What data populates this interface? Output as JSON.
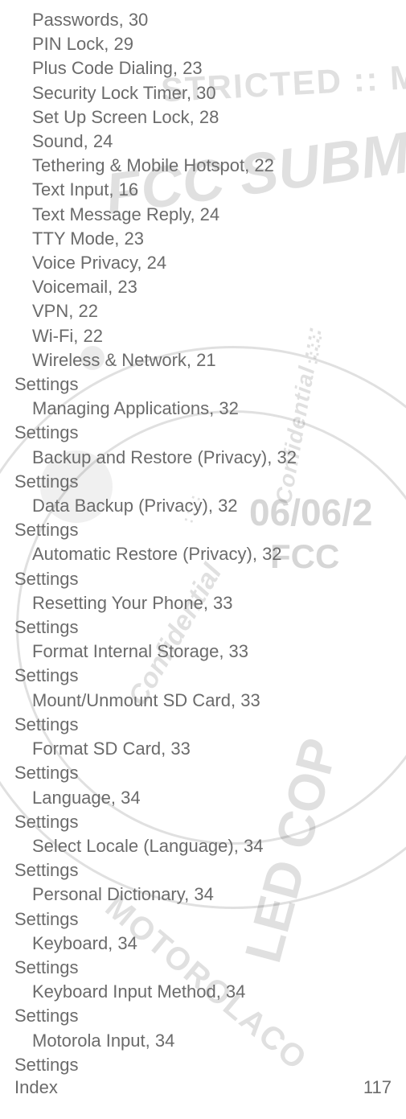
{
  "entries": [
    {
      "level": "sub",
      "text": "Passwords, 30"
    },
    {
      "level": "sub",
      "text": "PIN Lock, 29"
    },
    {
      "level": "sub",
      "text": "Plus Code Dialing, 23"
    },
    {
      "level": "sub",
      "text": "Security Lock Timer, 30"
    },
    {
      "level": "sub",
      "text": "Set Up Screen Lock, 28"
    },
    {
      "level": "sub",
      "text": "Sound, 24"
    },
    {
      "level": "sub",
      "text": "Tethering & Mobile Hotspot, 22"
    },
    {
      "level": "sub",
      "text": "Text Input, 16"
    },
    {
      "level": "sub",
      "text": "Text Message Reply, 24"
    },
    {
      "level": "sub",
      "text": "TTY Mode, 23"
    },
    {
      "level": "sub",
      "text": "Voice Privacy, 24"
    },
    {
      "level": "sub",
      "text": "Voicemail, 23"
    },
    {
      "level": "sub",
      "text": "VPN, 22"
    },
    {
      "level": "sub",
      "text": "Wi-Fi, 22"
    },
    {
      "level": "sub",
      "text": "Wireless & Network, 21"
    },
    {
      "level": "top",
      "text": "Settings"
    },
    {
      "level": "sub",
      "text": "Managing Applications, 32"
    },
    {
      "level": "top",
      "text": "Settings"
    },
    {
      "level": "sub",
      "text": "Backup and Restore (Privacy), 32"
    },
    {
      "level": "top",
      "text": "Settings"
    },
    {
      "level": "sub",
      "text": "Data Backup (Privacy), 32"
    },
    {
      "level": "top",
      "text": "Settings"
    },
    {
      "level": "sub",
      "text": "Automatic Restore (Privacy), 32"
    },
    {
      "level": "top",
      "text": "Settings"
    },
    {
      "level": "sub",
      "text": "Resetting Your Phone, 33"
    },
    {
      "level": "top",
      "text": "Settings"
    },
    {
      "level": "sub",
      "text": "Format Internal Storage, 33"
    },
    {
      "level": "top",
      "text": "Settings"
    },
    {
      "level": "sub",
      "text": "Mount/Unmount SD Card, 33"
    },
    {
      "level": "top",
      "text": "Settings"
    },
    {
      "level": "sub",
      "text": "Format SD Card, 33"
    },
    {
      "level": "top",
      "text": "Settings"
    },
    {
      "level": "sub",
      "text": "Language, 34"
    },
    {
      "level": "top",
      "text": "Settings"
    },
    {
      "level": "sub",
      "text": "Select Locale (Language), 34"
    },
    {
      "level": "top",
      "text": "Settings"
    },
    {
      "level": "sub",
      "text": "Personal Dictionary, 34"
    },
    {
      "level": "top",
      "text": "Settings"
    },
    {
      "level": "sub",
      "text": "Keyboard, 34"
    },
    {
      "level": "top",
      "text": "Settings"
    },
    {
      "level": "sub",
      "text": "Keyboard Input Method, 34"
    },
    {
      "level": "top",
      "text": "Settings"
    },
    {
      "level": "sub",
      "text": "Motorola Input, 34"
    },
    {
      "level": "top",
      "text": "Settings"
    }
  ],
  "footer": {
    "left": "Index",
    "right": "117"
  },
  "watermarks": {
    "restricted": "STRICTED :: M",
    "fcc_sub": "FCC SUBM",
    "confidential_top": "Confidential ::::",
    "date": "06/06/2",
    "fcc_small": "FCC",
    "confidential_mid": "Confidential",
    "led_cop": "LED COP",
    "motorola": "MOTOROLACO",
    "dots1": "::::",
    "dots2": ":::: "
  }
}
